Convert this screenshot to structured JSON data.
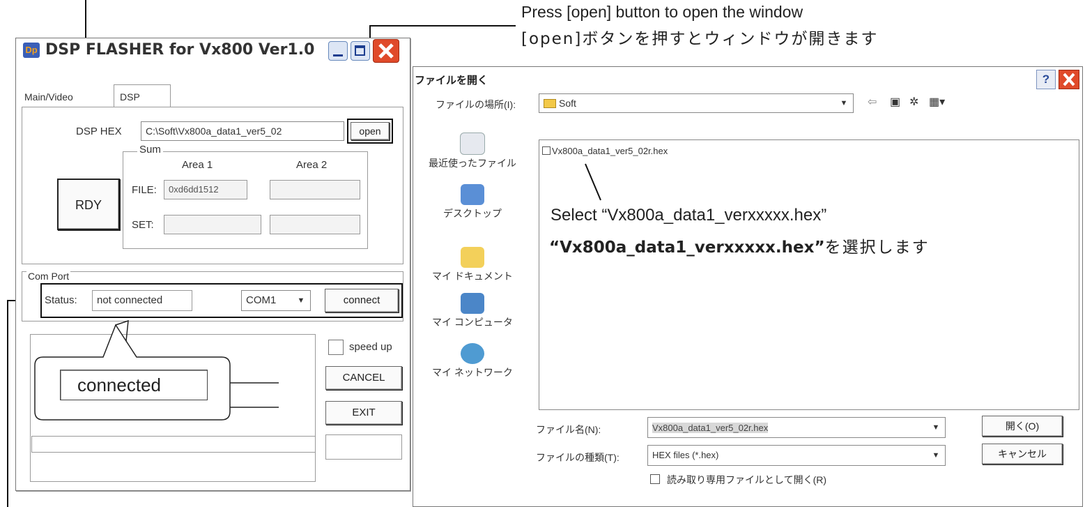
{
  "annotations": {
    "open_line1": "Press [open] button to open the window",
    "open_line2": "[open]ボタンを押すとウィンドウが開きます",
    "select_line1": "Select “Vx800a_data1_verxxxxx.hex”",
    "select_line2_quoted": "“Vx800a_data1_verxxxxx.hex”",
    "select_line2_suffix": "を選択します",
    "callout_connected": "connected"
  },
  "flasher": {
    "title": "DSP FLASHER for Vx800 Ver1.0",
    "app_icon": "Dp",
    "icons": [
      "minimize-icon",
      "maximize-icon",
      "close-icon"
    ],
    "tabs": [
      "Main/Video",
      "DSP"
    ],
    "dsp_hex_label": "DSP HEX",
    "dsp_hex_value": "C:\\Soft\\Vx800a_data1_ver5_02",
    "open_button": "open",
    "rdy_button": "RDY",
    "sum_legend": "Sum",
    "area1": "Area 1",
    "area2": "Area 2",
    "file_label": "FILE:",
    "file_area1_value": "0xd6dd1512",
    "set_label": "SET:",
    "com_port_legend": "Com Port",
    "status_label": "Status:",
    "status_value": "not connected",
    "com_selected": "COM1",
    "connect_button": "connect",
    "speed_up_label": "speed up",
    "speed_up_checked": false,
    "cancel_button": "CANCEL",
    "exit_button": "EXIT"
  },
  "dialog": {
    "title": "ファイルを開く",
    "help_icon": "?",
    "location_label": "ファイルの場所(I):",
    "location_value": "Soft",
    "file_list": [
      "Vx800a_data1_ver5_02r.hex"
    ],
    "places": [
      {
        "label": "最近使ったファイル",
        "icon": "recent-files-icon"
      },
      {
        "label": "デスクトップ",
        "icon": "desktop-icon"
      },
      {
        "label": "マイ ドキュメント",
        "icon": "my-documents-icon"
      },
      {
        "label": "マイ コンピュータ",
        "icon": "my-computer-icon"
      },
      {
        "label": "マイ ネットワーク",
        "icon": "my-network-icon"
      }
    ],
    "filename_label": "ファイル名(N):",
    "filename_value": "Vx800a_data1_ver5_02r.hex",
    "filetype_label": "ファイルの種類(T):",
    "filetype_value": "HEX files (*.hex)",
    "readonly_label": "読み取り専用ファイルとして開く(R)",
    "readonly_checked": false,
    "open_button": "開く(O)",
    "cancel_button": "キャンセル"
  }
}
